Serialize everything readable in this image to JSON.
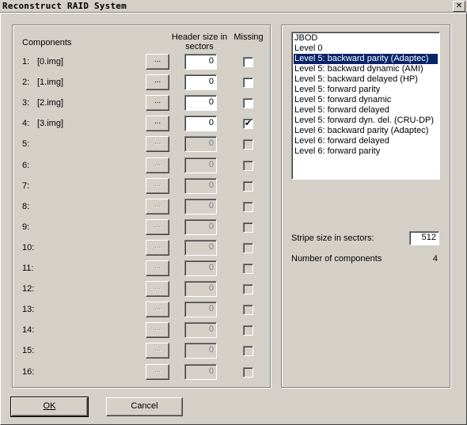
{
  "window": {
    "title": "Reconstruct RAID System",
    "close_glyph": "✕"
  },
  "components": {
    "header_components": "Components",
    "header_size": "Header size in sectors",
    "header_missing": "Missing",
    "browse_label": "...",
    "rows": [
      {
        "num": "1:",
        "name": "[0.img]",
        "header": "0",
        "missing": false,
        "enabled": true
      },
      {
        "num": "2:",
        "name": "[1.img]",
        "header": "0",
        "missing": false,
        "enabled": true
      },
      {
        "num": "3:",
        "name": "[2.img]",
        "header": "0",
        "missing": false,
        "enabled": true
      },
      {
        "num": "4:",
        "name": "[3.img]",
        "header": "0",
        "missing": true,
        "enabled": true
      },
      {
        "num": "5:",
        "name": "",
        "header": "0",
        "missing": false,
        "enabled": false
      },
      {
        "num": "6:",
        "name": "",
        "header": "0",
        "missing": false,
        "enabled": false
      },
      {
        "num": "7:",
        "name": "",
        "header": "0",
        "missing": false,
        "enabled": false
      },
      {
        "num": "8:",
        "name": "",
        "header": "0",
        "missing": false,
        "enabled": false
      },
      {
        "num": "9:",
        "name": "",
        "header": "0",
        "missing": false,
        "enabled": false
      },
      {
        "num": "10:",
        "name": "",
        "header": "0",
        "missing": false,
        "enabled": false
      },
      {
        "num": "11:",
        "name": "",
        "header": "0",
        "missing": false,
        "enabled": false
      },
      {
        "num": "12:",
        "name": "",
        "header": "0",
        "missing": false,
        "enabled": false
      },
      {
        "num": "13:",
        "name": "",
        "header": "0",
        "missing": false,
        "enabled": false
      },
      {
        "num": "14:",
        "name": "",
        "header": "0",
        "missing": false,
        "enabled": false
      },
      {
        "num": "15:",
        "name": "",
        "header": "0",
        "missing": false,
        "enabled": false
      },
      {
        "num": "16:",
        "name": "",
        "header": "0",
        "missing": false,
        "enabled": false
      }
    ]
  },
  "raid_types": {
    "items": [
      "JBOD",
      "Level 0",
      "Level 5: backward parity (Adaptec)",
      "Level 5: backward dynamic (AMI)",
      "Level 5: backward delayed (HP)",
      "Level 5: forward parity",
      "Level 5: forward dynamic",
      "Level 5: forward delayed",
      "Level 5: forward dyn. del. (CRU-DP)",
      "Level 6: backward parity (Adaptec)",
      "Level 6: forward delayed",
      "Level 6: forward parity"
    ],
    "selected": "Level 5: backward parity (Adaptec)"
  },
  "stripe": {
    "label": "Stripe size in sectors:",
    "value": "512"
  },
  "num_components": {
    "label": "Number of components",
    "value": "4"
  },
  "buttons": {
    "ok": "OK",
    "cancel": "Cancel"
  },
  "check_glyph": "✔"
}
